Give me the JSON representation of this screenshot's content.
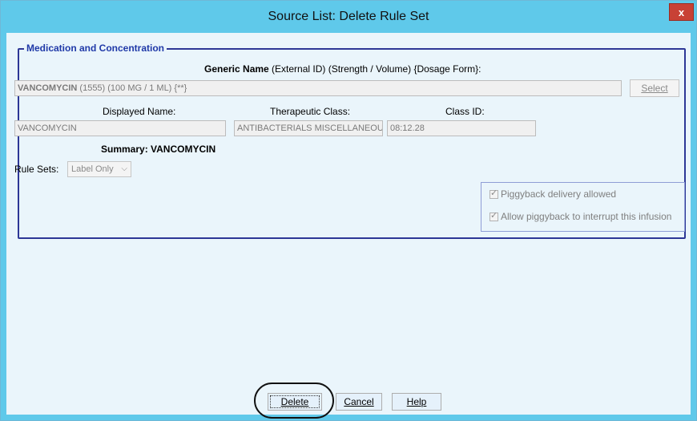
{
  "window": {
    "title": "Source List:  Delete Rule Set",
    "close_label": "x"
  },
  "medication": {
    "group_title": "Medication and Concentration",
    "generic_header": {
      "bold": "Generic Name",
      "rest": " (External ID)  (Strength / Volume)  {Dosage Form}:"
    },
    "generic_value": {
      "bold": "VANCOMYCIN",
      "rest": " (1555) (100 MG / 1 ML) {**}"
    },
    "select_label": "Select",
    "displayed_name_label": "Displayed Name:",
    "displayed_name_value": "VANCOMYCIN",
    "therapeutic_class_label": "Therapeutic Class:",
    "therapeutic_class_value": "ANTIBACTERIALS MISCELLANEOU",
    "class_id_label": "Class ID:",
    "class_id_value": "08:12.28",
    "summary_label": "Summary: VANCOMYCIN",
    "rule_sets_label": "Rule Sets:",
    "rule_sets_value": "Label Only",
    "piggyback_allowed_label": "Piggyback delivery allowed",
    "piggyback_interrupt_label": "Allow piggyback to interrupt this infusion"
  },
  "buttons": {
    "delete": "Delete",
    "cancel": "Cancel",
    "help": "Help"
  },
  "colors": {
    "title_bar": "#5fc9ea",
    "close": "#c84135",
    "group_border": "#2d3796",
    "group_title": "#1f39a8",
    "client_bg": "#eaf5fb"
  },
  "icons": {
    "close": "close-icon",
    "dropdown": "chevron-down-icon",
    "checkbox": "checkbox-checked-icon"
  }
}
